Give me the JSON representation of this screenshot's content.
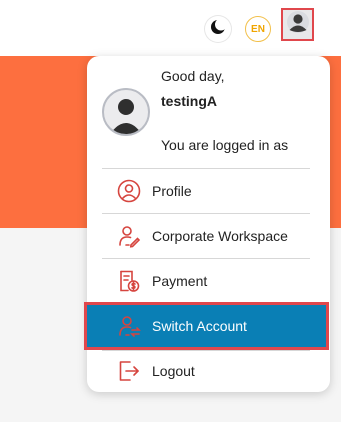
{
  "header": {
    "language_label": "EN",
    "theme_icon": "moon-icon",
    "avatar_icon": "user-avatar-icon"
  },
  "user_menu": {
    "greeting": "Good day,",
    "username": "testingA",
    "logged_in_text": "You are logged in as",
    "items": [
      {
        "label": "Profile",
        "icon": "user-circle-icon"
      },
      {
        "label": "Corporate Workspace",
        "icon": "user-edit-icon"
      },
      {
        "label": "Payment",
        "icon": "invoice-dollar-icon"
      },
      {
        "label": "Switch Account",
        "icon": "user-switch-icon",
        "selected": true
      },
      {
        "label": "Logout",
        "icon": "logout-icon"
      }
    ]
  },
  "colors": {
    "brand_orange": "#fd6f3f",
    "accent_red": "#e0474c",
    "selected_blue": "#0a7fb5",
    "icon_red": "#d6453f"
  }
}
